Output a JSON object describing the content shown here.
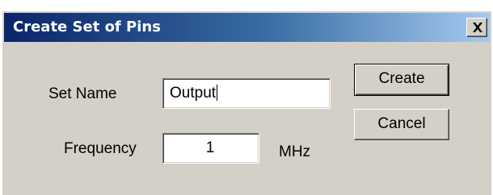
{
  "dialog": {
    "title": "Create Set of Pins",
    "close_icon": "close-icon"
  },
  "form": {
    "set_name_label": "Set Name",
    "set_name_value": "Output",
    "frequency_label": "Frequency",
    "frequency_value": "1",
    "frequency_unit": "MHz"
  },
  "buttons": {
    "create_label": "Create",
    "cancel_label": "Cancel"
  },
  "colors": {
    "titlebar_start": "#0a246a",
    "titlebar_end": "#a6caf0",
    "face": "#d4d0c8"
  }
}
